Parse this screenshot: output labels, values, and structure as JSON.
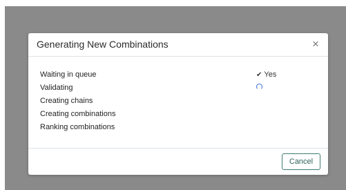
{
  "modal": {
    "title": "Generating New Combinations",
    "close_icon": "close-icon",
    "close_glyph": "×",
    "steps": [
      {
        "label": "Waiting in queue",
        "status": "done",
        "status_text": "Yes"
      },
      {
        "label": "Validating",
        "status": "in-progress",
        "status_text": ""
      },
      {
        "label": "Creating chains",
        "status": "pending",
        "status_text": ""
      },
      {
        "label": "Creating combinations",
        "status": "pending",
        "status_text": ""
      },
      {
        "label": "Ranking combinations",
        "status": "pending",
        "status_text": ""
      }
    ],
    "check_icon": "checkmark-icon",
    "check_glyph": "✔",
    "spinner_icon": "spinner-icon",
    "cancel_label": "Cancel"
  },
  "colors": {
    "backdrop": "#8a8a8a",
    "spinner": "#3a6fd8",
    "cancel_border": "#3f7b72",
    "cancel_text": "#2e5f58"
  }
}
